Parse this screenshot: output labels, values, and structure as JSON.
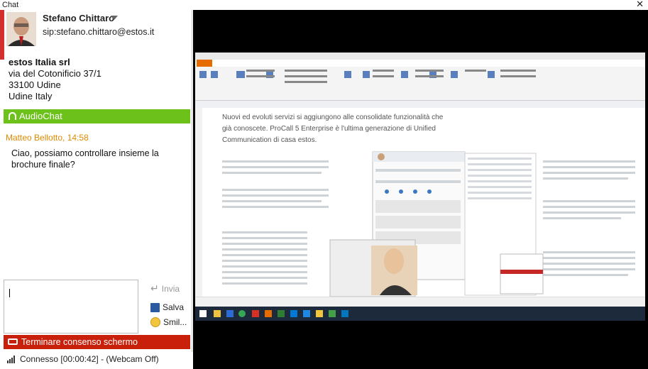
{
  "window": {
    "title": "Chat",
    "close_glyph": "✕"
  },
  "contact": {
    "name": "Stefano Chittaro",
    "sip": "sip:stefano.chittaro@estos.it",
    "company": "estos Italia srl",
    "street": "via del Cotonificio 37/1",
    "zip_city": "33100 Udine",
    "region_country": "Udine Italy"
  },
  "audio": {
    "label": "AudioChat",
    "icon": "headset-icon"
  },
  "message": {
    "author_time": "Matteo Bellotto, 14:58",
    "text": "Ciao, possiamo controllare insieme la brochure finale?"
  },
  "actions": {
    "send": "Invia",
    "save": "Salva",
    "smiley": "Smil..."
  },
  "share": {
    "terminate": "Terminare consenso schermo"
  },
  "status": {
    "text": "Connesso [00:00:42] - (Webcam Off)"
  },
  "doc": {
    "heading_line1": "Nuovi ed evoluti servizi si aggiungono alle consolidate funzionalità che",
    "heading_line2": "già conoscete. ProCall 5 Enterprise è l'ultima generazione di Unified",
    "heading_line3": "Communication di casa estos."
  },
  "colors": {
    "audio_green": "#6cc11b",
    "terminate_red": "#c8200b",
    "contact_red": "#d32f2f",
    "time_orange": "#e08a00"
  }
}
